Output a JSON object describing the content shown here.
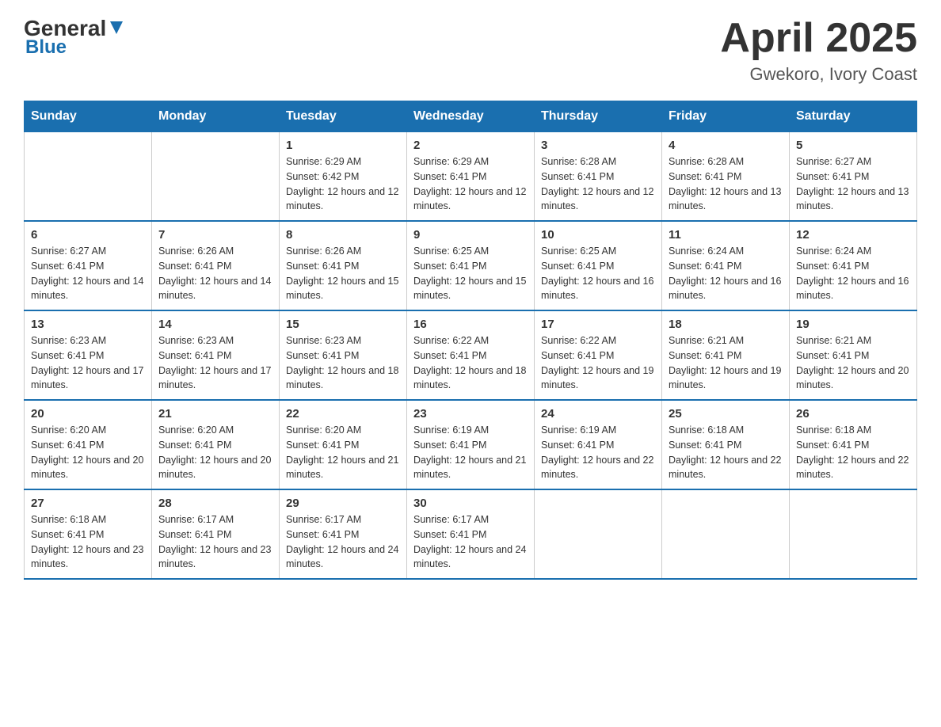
{
  "header": {
    "logo_general": "General",
    "logo_blue": "Blue",
    "month_title": "April 2025",
    "location": "Gwekoro, Ivory Coast"
  },
  "weekdays": [
    "Sunday",
    "Monday",
    "Tuesday",
    "Wednesday",
    "Thursday",
    "Friday",
    "Saturday"
  ],
  "weeks": [
    [
      {
        "day": "",
        "sunrise": "",
        "sunset": "",
        "daylight": ""
      },
      {
        "day": "",
        "sunrise": "",
        "sunset": "",
        "daylight": ""
      },
      {
        "day": "1",
        "sunrise": "Sunrise: 6:29 AM",
        "sunset": "Sunset: 6:42 PM",
        "daylight": "Daylight: 12 hours and 12 minutes."
      },
      {
        "day": "2",
        "sunrise": "Sunrise: 6:29 AM",
        "sunset": "Sunset: 6:41 PM",
        "daylight": "Daylight: 12 hours and 12 minutes."
      },
      {
        "day": "3",
        "sunrise": "Sunrise: 6:28 AM",
        "sunset": "Sunset: 6:41 PM",
        "daylight": "Daylight: 12 hours and 12 minutes."
      },
      {
        "day": "4",
        "sunrise": "Sunrise: 6:28 AM",
        "sunset": "Sunset: 6:41 PM",
        "daylight": "Daylight: 12 hours and 13 minutes."
      },
      {
        "day": "5",
        "sunrise": "Sunrise: 6:27 AM",
        "sunset": "Sunset: 6:41 PM",
        "daylight": "Daylight: 12 hours and 13 minutes."
      }
    ],
    [
      {
        "day": "6",
        "sunrise": "Sunrise: 6:27 AM",
        "sunset": "Sunset: 6:41 PM",
        "daylight": "Daylight: 12 hours and 14 minutes."
      },
      {
        "day": "7",
        "sunrise": "Sunrise: 6:26 AM",
        "sunset": "Sunset: 6:41 PM",
        "daylight": "Daylight: 12 hours and 14 minutes."
      },
      {
        "day": "8",
        "sunrise": "Sunrise: 6:26 AM",
        "sunset": "Sunset: 6:41 PM",
        "daylight": "Daylight: 12 hours and 15 minutes."
      },
      {
        "day": "9",
        "sunrise": "Sunrise: 6:25 AM",
        "sunset": "Sunset: 6:41 PM",
        "daylight": "Daylight: 12 hours and 15 minutes."
      },
      {
        "day": "10",
        "sunrise": "Sunrise: 6:25 AM",
        "sunset": "Sunset: 6:41 PM",
        "daylight": "Daylight: 12 hours and 16 minutes."
      },
      {
        "day": "11",
        "sunrise": "Sunrise: 6:24 AM",
        "sunset": "Sunset: 6:41 PM",
        "daylight": "Daylight: 12 hours and 16 minutes."
      },
      {
        "day": "12",
        "sunrise": "Sunrise: 6:24 AM",
        "sunset": "Sunset: 6:41 PM",
        "daylight": "Daylight: 12 hours and 16 minutes."
      }
    ],
    [
      {
        "day": "13",
        "sunrise": "Sunrise: 6:23 AM",
        "sunset": "Sunset: 6:41 PM",
        "daylight": "Daylight: 12 hours and 17 minutes."
      },
      {
        "day": "14",
        "sunrise": "Sunrise: 6:23 AM",
        "sunset": "Sunset: 6:41 PM",
        "daylight": "Daylight: 12 hours and 17 minutes."
      },
      {
        "day": "15",
        "sunrise": "Sunrise: 6:23 AM",
        "sunset": "Sunset: 6:41 PM",
        "daylight": "Daylight: 12 hours and 18 minutes."
      },
      {
        "day": "16",
        "sunrise": "Sunrise: 6:22 AM",
        "sunset": "Sunset: 6:41 PM",
        "daylight": "Daylight: 12 hours and 18 minutes."
      },
      {
        "day": "17",
        "sunrise": "Sunrise: 6:22 AM",
        "sunset": "Sunset: 6:41 PM",
        "daylight": "Daylight: 12 hours and 19 minutes."
      },
      {
        "day": "18",
        "sunrise": "Sunrise: 6:21 AM",
        "sunset": "Sunset: 6:41 PM",
        "daylight": "Daylight: 12 hours and 19 minutes."
      },
      {
        "day": "19",
        "sunrise": "Sunrise: 6:21 AM",
        "sunset": "Sunset: 6:41 PM",
        "daylight": "Daylight: 12 hours and 20 minutes."
      }
    ],
    [
      {
        "day": "20",
        "sunrise": "Sunrise: 6:20 AM",
        "sunset": "Sunset: 6:41 PM",
        "daylight": "Daylight: 12 hours and 20 minutes."
      },
      {
        "day": "21",
        "sunrise": "Sunrise: 6:20 AM",
        "sunset": "Sunset: 6:41 PM",
        "daylight": "Daylight: 12 hours and 20 minutes."
      },
      {
        "day": "22",
        "sunrise": "Sunrise: 6:20 AM",
        "sunset": "Sunset: 6:41 PM",
        "daylight": "Daylight: 12 hours and 21 minutes."
      },
      {
        "day": "23",
        "sunrise": "Sunrise: 6:19 AM",
        "sunset": "Sunset: 6:41 PM",
        "daylight": "Daylight: 12 hours and 21 minutes."
      },
      {
        "day": "24",
        "sunrise": "Sunrise: 6:19 AM",
        "sunset": "Sunset: 6:41 PM",
        "daylight": "Daylight: 12 hours and 22 minutes."
      },
      {
        "day": "25",
        "sunrise": "Sunrise: 6:18 AM",
        "sunset": "Sunset: 6:41 PM",
        "daylight": "Daylight: 12 hours and 22 minutes."
      },
      {
        "day": "26",
        "sunrise": "Sunrise: 6:18 AM",
        "sunset": "Sunset: 6:41 PM",
        "daylight": "Daylight: 12 hours and 22 minutes."
      }
    ],
    [
      {
        "day": "27",
        "sunrise": "Sunrise: 6:18 AM",
        "sunset": "Sunset: 6:41 PM",
        "daylight": "Daylight: 12 hours and 23 minutes."
      },
      {
        "day": "28",
        "sunrise": "Sunrise: 6:17 AM",
        "sunset": "Sunset: 6:41 PM",
        "daylight": "Daylight: 12 hours and 23 minutes."
      },
      {
        "day": "29",
        "sunrise": "Sunrise: 6:17 AM",
        "sunset": "Sunset: 6:41 PM",
        "daylight": "Daylight: 12 hours and 24 minutes."
      },
      {
        "day": "30",
        "sunrise": "Sunrise: 6:17 AM",
        "sunset": "Sunset: 6:41 PM",
        "daylight": "Daylight: 12 hours and 24 minutes."
      },
      {
        "day": "",
        "sunrise": "",
        "sunset": "",
        "daylight": ""
      },
      {
        "day": "",
        "sunrise": "",
        "sunset": "",
        "daylight": ""
      },
      {
        "day": "",
        "sunrise": "",
        "sunset": "",
        "daylight": ""
      }
    ]
  ]
}
